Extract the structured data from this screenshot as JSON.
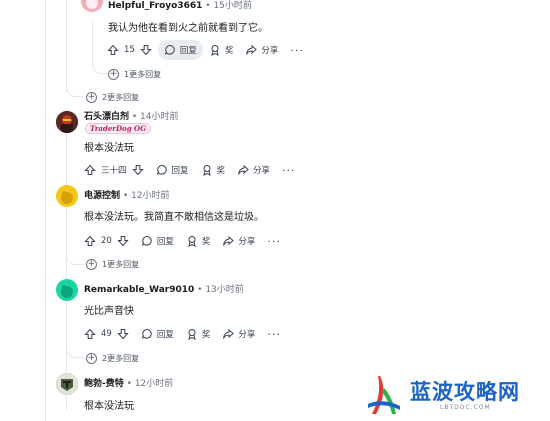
{
  "comments": [
    {
      "username": "Helpful_Froyo3661",
      "time": "15小时前",
      "body": "我认为他在看到火之前就看到了它。",
      "votes": "15",
      "reply_label": "回复",
      "award_label": "奖",
      "share_label": "分享",
      "more_replies": "1更多回复"
    },
    {
      "username": "石头漂白剂",
      "time": "14小时前",
      "flair": "TraderDog OG",
      "body": "根本没法玩",
      "votes": "三十四",
      "reply_label": "回复",
      "award_label": "奖",
      "share_label": "分享"
    },
    {
      "username": "电源控制",
      "time": "12小时前",
      "body": "根本没法玩。我简直不敢相信这是垃圾。",
      "votes": "20",
      "reply_label": "回复",
      "award_label": "奖",
      "share_label": "分享",
      "more_replies": "1更多回复"
    },
    {
      "username": "Remarkable_War9010",
      "time": "13小时前",
      "body": "光比声音快",
      "votes": "49",
      "reply_label": "回复",
      "award_label": "奖",
      "share_label": "分享",
      "more_replies": "2更多回复"
    },
    {
      "username": "鲍勃-费特",
      "time": "12小时前",
      "body": "根本没法玩"
    }
  ],
  "thread": {
    "more_replies_top": "2更多回复"
  },
  "watermark": {
    "title": "蓝波攻略网",
    "url": "LBTDOC.COM"
  },
  "colors": {
    "avatar_froyo": "#f7a9b4",
    "avatar_power": "#f5c518",
    "avatar_remarkable": "#1ad6a2",
    "watermark_blue": "#1a63c9",
    "watermark_red": "#e8382f",
    "watermark_green": "#2eb24a"
  }
}
